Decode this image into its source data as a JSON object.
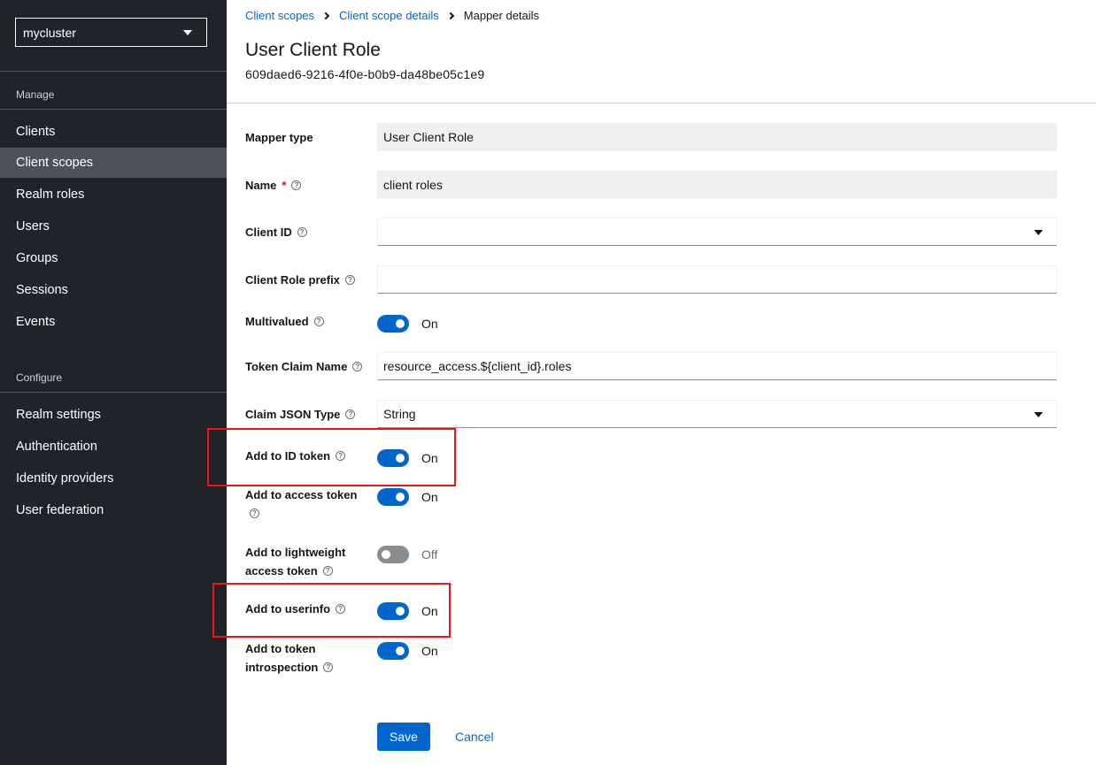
{
  "sidebar": {
    "realm": "mycluster",
    "manage_title": "Manage",
    "manage_items": [
      "Clients",
      "Client scopes",
      "Realm roles",
      "Users",
      "Groups",
      "Sessions",
      "Events"
    ],
    "configure_title": "Configure",
    "configure_items": [
      "Realm settings",
      "Authentication",
      "Identity providers",
      "User federation"
    ]
  },
  "breadcrumb": {
    "item1": "Client scopes",
    "item2": "Client scope details",
    "current": "Mapper details"
  },
  "header": {
    "title": "User Client Role",
    "id": "609daed6-9216-4f0e-b0b9-da48be05c1e9"
  },
  "form": {
    "mapper_type_label": "Mapper type",
    "mapper_type_value": "User Client Role",
    "name_label": "Name",
    "name_required": "*",
    "name_value": "client roles",
    "client_id_label": "Client ID",
    "client_id_value": "",
    "client_role_prefix_label": "Client Role prefix",
    "client_role_prefix_value": "",
    "multivalued_label": "Multivalued",
    "multivalued_state": "On",
    "token_claim_name_label": "Token Claim Name",
    "token_claim_name_value": "resource_access.${client_id}.roles",
    "claim_json_type_label": "Claim JSON Type",
    "claim_json_type_value": "String",
    "add_id_token_label": "Add to ID token",
    "add_id_token_state": "On",
    "add_access_token_label": "Add to access token",
    "add_access_token_state": "On",
    "add_lightweight_label_1": "Add to lightweight",
    "add_lightweight_label_2": "access token",
    "add_lightweight_state": "Off",
    "add_userinfo_label": "Add to userinfo",
    "add_userinfo_state": "On",
    "add_introspection_label_1": "Add to token",
    "add_introspection_label_2": "introspection",
    "add_introspection_state": "On"
  },
  "actions": {
    "save": "Save",
    "cancel": "Cancel"
  },
  "colors": {
    "sidebar_bg": "#212427",
    "active_nav": "#4f5255",
    "primary": "#0066cc",
    "highlight": "#e8161b"
  }
}
